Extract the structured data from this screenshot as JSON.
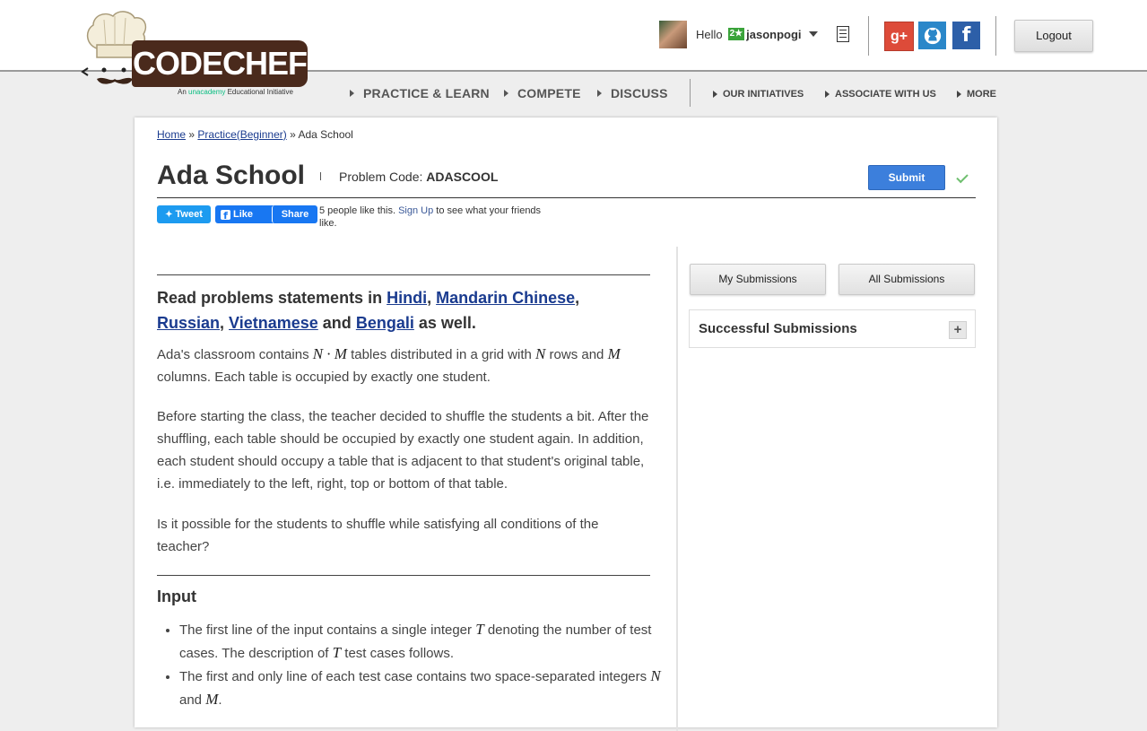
{
  "logo": {
    "text": "CODECHEF",
    "tag_prefix": "An ",
    "tag_brand": "unacademy",
    "tag_suffix": " Educational Initiative"
  },
  "user": {
    "greeting": "Hello",
    "badge": "2★",
    "username": "jasonpogi"
  },
  "social": {
    "gplus": "g+",
    "facebook": "f"
  },
  "header": {
    "logout_label": "Logout"
  },
  "nav": {
    "main": [
      "PRACTICE & LEARN",
      "COMPETE",
      "DISCUSS"
    ],
    "secondary": [
      "OUR INITIATIVES",
      "ASSOCIATE WITH US",
      "MORE"
    ]
  },
  "breadcrumb": {
    "home": "Home",
    "sep": "»",
    "practice": "Practice(Beginner)",
    "current": "Ada School"
  },
  "problem": {
    "title": "Ada School",
    "code_label": "Problem Code:",
    "code": "ADASCOOL",
    "submit_label": "Submit"
  },
  "share": {
    "tweet": "Tweet",
    "like": "Like",
    "share": "Share",
    "like_count_text": "5 people like this.",
    "signup": "Sign Up",
    "like_suffix": "to see what your friends like."
  },
  "statement": {
    "read_prefix": "Read problems statements in",
    "langs": [
      "Hindi",
      "Mandarin Chinese",
      "Russian",
      "Vietnamese",
      "Bengali"
    ],
    "and_word": "and",
    "as_well": "as well.",
    "p1_a": "Ada's classroom contains",
    "p1_b": "tables distributed in a grid with",
    "p1_c": "rows and",
    "p1_d": "columns. Each table is occupied by exactly one student.",
    "p2": "Before starting the class, the teacher decided to shuffle the students a bit. After the shuffling, each table should be occupied by exactly one student again. In addition, each student should occupy a table that is adjacent to that student's original table, i.e. immediately to the left, right, top or bottom of that table.",
    "p3": "Is it possible for the students to shuffle while satisfying all conditions of the teacher?",
    "input_heading": "Input",
    "li1_a": "The first line of the input contains a single integer",
    "li1_b": "denoting the number of test cases. The description of",
    "li1_c": "test cases follows.",
    "li2_a": "The first and only line of each test case contains two space-separated integers",
    "li2_b": "and"
  },
  "math": {
    "N": "N",
    "M": "M",
    "T": "T",
    "dot": "·"
  },
  "sidebar": {
    "my_submissions": "My Submissions",
    "all_submissions": "All Submissions",
    "successful_title": "Successful Submissions",
    "expand": "+"
  },
  "colors": {
    "submit_blue": "#3c7fdc",
    "link_blue": "#1a3b8f",
    "logo_brown": "#4a2a1c"
  }
}
